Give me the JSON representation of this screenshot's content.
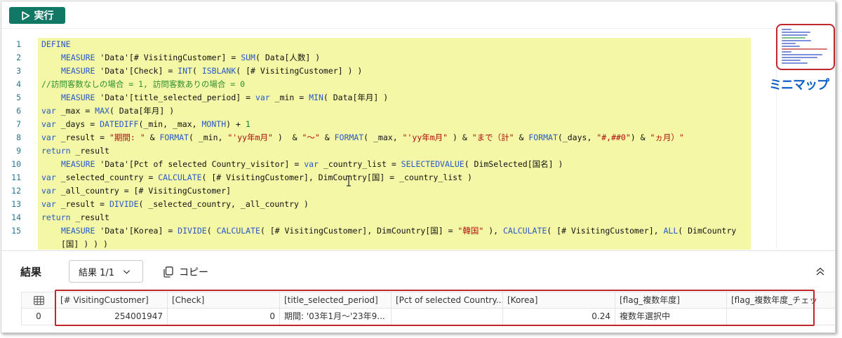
{
  "toolbar": {
    "run_label": "実行"
  },
  "editor": {
    "line_numbers": [
      "1",
      "2",
      "3",
      "4",
      "5",
      "6",
      "7",
      "8",
      "9",
      "10",
      "11",
      "12",
      "13",
      "14",
      "15",
      ""
    ]
  },
  "minimap": {
    "label": "ミニマップ"
  },
  "results": {
    "title": "結果",
    "selector_value": "結果 1/1",
    "copy_label": "コピー",
    "columns": [
      "[# VisitingCustomer]",
      "[Check]",
      "[title_selected_period]",
      "[Pct of selected Country...",
      "[Korea]",
      "[flag_複数年度]",
      "[flag_複数年度_チェッ"
    ],
    "rows": [
      {
        "index": "0",
        "cells": [
          "254001947",
          "0",
          "期間: '03年1月〜'23年9...",
          "",
          "0.24",
          "複数年選択中",
          ""
        ]
      }
    ]
  },
  "colors": {
    "accent": "#117865",
    "highlight": "#c0272d",
    "code_bg": "#f3f7a6"
  }
}
